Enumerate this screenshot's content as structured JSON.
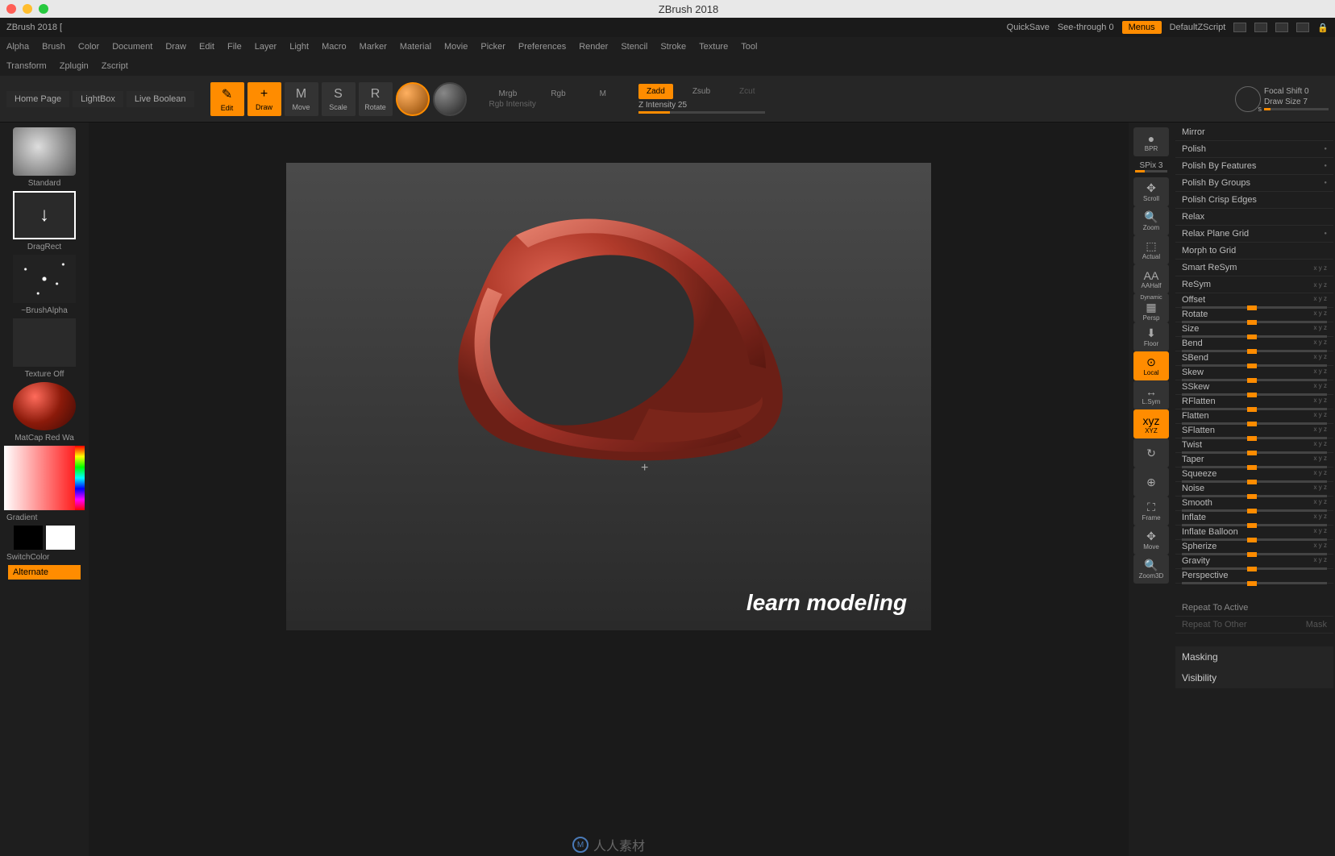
{
  "titlebar": {
    "title": "ZBrush 2018"
  },
  "topbar": {
    "title": "ZBrush 2018 [",
    "quicksave": "QuickSave",
    "seethrough": "See-through   0",
    "menus": "Menus",
    "zscript": "DefaultZScript"
  },
  "menubar": [
    "Alpha",
    "Brush",
    "Color",
    "Document",
    "Draw",
    "Edit",
    "File",
    "Layer",
    "Light",
    "Macro",
    "Marker",
    "Material",
    "Movie",
    "Picker",
    "Preferences",
    "Render",
    "Stencil",
    "Stroke",
    "Texture",
    "Tool"
  ],
  "menubar2": [
    "Transform",
    "Zplugin",
    "Zscript"
  ],
  "toolbar": {
    "homepage": "Home Page",
    "lightbox": "LightBox",
    "liveboolean": "Live Boolean",
    "tools": [
      {
        "label": "Edit",
        "active": true
      },
      {
        "label": "Draw",
        "active": true
      },
      {
        "label": "Move",
        "active": false
      },
      {
        "label": "Scale",
        "active": false
      },
      {
        "label": "Rotate",
        "active": false
      }
    ],
    "modes": {
      "mrgb": "Mrgb",
      "rgb": "Rgb",
      "m": "M",
      "rgb_intensity": "Rgb Intensity",
      "zadd": "Zadd",
      "zsub": "Zsub",
      "zcut": "Zcut",
      "z_intensity": "Z Intensity 25"
    },
    "focal_shift": "Focal Shift 0",
    "draw_size": "Draw Size 7"
  },
  "left": {
    "brush": "Standard",
    "stroke": "DragRect",
    "alpha": "~BrushAlpha",
    "texture": "Texture Off",
    "material": "MatCap Red Wa",
    "gradient": "Gradient",
    "switchcolor": "SwitchColor",
    "alternate": "Alternate"
  },
  "canvas": {
    "watermark": "learn modeling",
    "footer_text": "人人素材"
  },
  "right_tools": {
    "bpr": "BPR",
    "spix": "SPix 3",
    "items": [
      {
        "label": "Scroll",
        "ico": "✥"
      },
      {
        "label": "Zoom",
        "ico": "🔍"
      },
      {
        "label": "Actual",
        "ico": "⬚"
      },
      {
        "label": "AAHalf",
        "ico": "AA"
      },
      {
        "label": "Persp",
        "ico": "▦",
        "sub": "Dynamic"
      },
      {
        "label": "Floor",
        "ico": "⬇"
      },
      {
        "label": "Local",
        "ico": "⊙",
        "active": true
      },
      {
        "label": "L.Sym",
        "ico": "↔"
      },
      {
        "label": "XYZ",
        "ico": "xyz",
        "active": true
      },
      {
        "label": "",
        "ico": "↻"
      },
      {
        "label": "",
        "ico": "⊕"
      },
      {
        "label": "Frame",
        "ico": "⛶"
      },
      {
        "label": "Move",
        "ico": "✥"
      },
      {
        "label": "Zoom3D",
        "ico": "🔍"
      }
    ]
  },
  "right_panel": {
    "items_top": [
      {
        "label": "Mirror"
      },
      {
        "label": "Polish",
        "dot": true
      },
      {
        "label": "Polish By Features",
        "dot": true
      },
      {
        "label": "Polish By Groups",
        "dot": true
      },
      {
        "label": "Polish Crisp Edges"
      },
      {
        "label": "Relax"
      },
      {
        "label": "Relax Plane Grid",
        "dot": true
      },
      {
        "label": "Morph to Grid"
      },
      {
        "label": "Smart ReSym",
        "xyz": true
      },
      {
        "label": "ReSym",
        "xyz": true
      },
      {
        "label": "Offset",
        "xyz": true,
        "slider": 45
      },
      {
        "label": "Rotate",
        "xyz": true,
        "slider": 45
      },
      {
        "label": "Size",
        "xyz": true,
        "slider": 45
      },
      {
        "label": "Bend",
        "xyz": true,
        "slider": 45
      },
      {
        "label": "SBend",
        "xyz": true,
        "slider": 45
      },
      {
        "label": "Skew",
        "xyz": true,
        "slider": 45
      },
      {
        "label": "SSkew",
        "xyz": true,
        "slider": 45
      },
      {
        "label": "RFlatten",
        "xyz": true,
        "slider": 45
      },
      {
        "label": "Flatten",
        "xyz": true,
        "slider": 45
      },
      {
        "label": "SFlatten",
        "xyz": true,
        "slider": 45
      },
      {
        "label": "Twist",
        "xyz": true,
        "slider": 45
      },
      {
        "label": "Taper",
        "xyz": true,
        "slider": 45
      },
      {
        "label": "Squeeze",
        "xyz": true,
        "slider": 45
      },
      {
        "label": "Noise",
        "xyz": true,
        "slider": 45
      },
      {
        "label": "Smooth",
        "xyz": true,
        "slider": 45
      },
      {
        "label": "Inflate",
        "xyz": true,
        "slider": 45
      },
      {
        "label": "Inflate Balloon",
        "xyz": true,
        "slider": 45
      },
      {
        "label": "Spherize",
        "xyz": true,
        "slider": 45
      },
      {
        "label": "Gravity",
        "xyz": true,
        "slider": 45
      },
      {
        "label": "Perspective",
        "slider": 45
      }
    ],
    "repeat_active": "Repeat To Active",
    "repeat_other": "Repeat To Other",
    "mask": "Mask",
    "sections": [
      "Masking",
      "Visibility"
    ]
  }
}
